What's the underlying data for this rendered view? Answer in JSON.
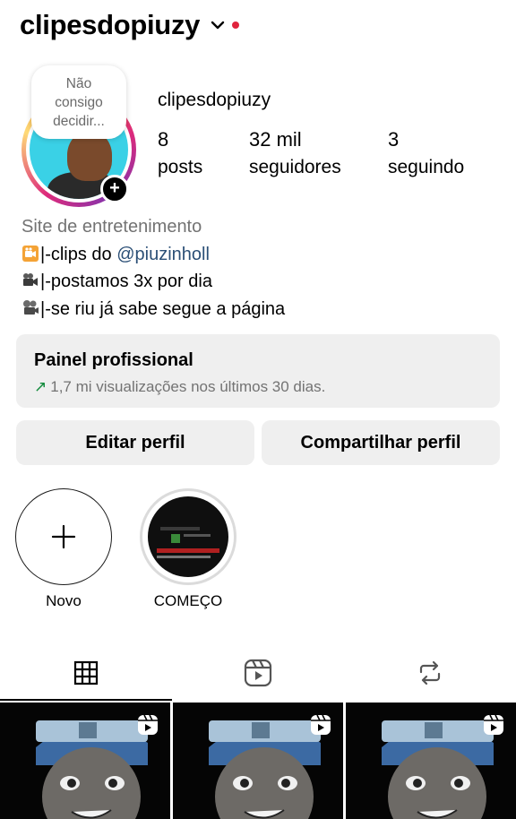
{
  "header": {
    "username": "clipesdopiuzy",
    "notification_dot_color": "#e0243d"
  },
  "profile": {
    "note": "Não consigo decidir...",
    "name": "clipesdopiuzy",
    "stats": {
      "posts": {
        "value": "8",
        "label": "posts"
      },
      "followers": {
        "value": "32 mil",
        "label": "seguidores"
      },
      "following": {
        "value": "3",
        "label": "seguindo"
      }
    }
  },
  "bio": {
    "category": "Site de entretenimento",
    "line1_prefix": "|-clips do ",
    "line1_mention": "@piuzinholl",
    "line2": "|-postamos 3x por dia",
    "line3": "|-se riu já sabe segue a página"
  },
  "dashboard": {
    "title": "Painel profissional",
    "arrow": "↗",
    "subtitle": "1,7 mi visualizações nos últimos 30 dias."
  },
  "buttons": {
    "edit": "Editar perfil",
    "share": "Compartilhar perfil"
  },
  "highlights": [
    {
      "label": "Novo"
    },
    {
      "label": "COMEÇO"
    }
  ],
  "tabs": [
    "grid-icon",
    "reels-icon",
    "tagged-repost-icon"
  ]
}
